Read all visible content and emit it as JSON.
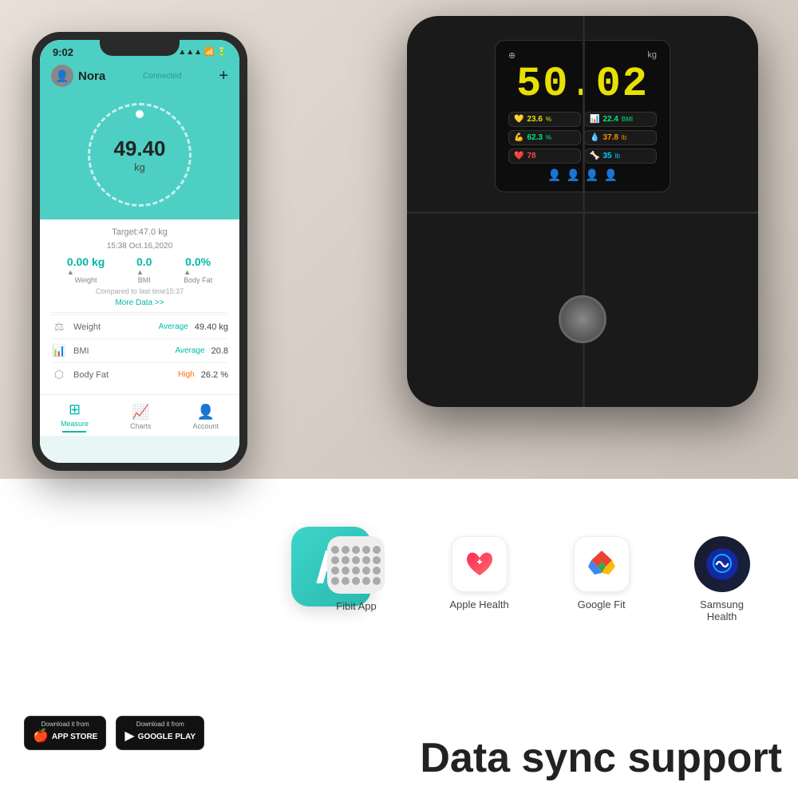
{
  "background": {
    "top_color": "#d8cfc6",
    "bottom_color": "#ffffff"
  },
  "scale": {
    "main_weight": "50.02",
    "unit": "kg",
    "metrics": [
      {
        "icon": "fat",
        "value": "23.6",
        "unit": "%",
        "color": "yellow",
        "label": "Body Fat"
      },
      {
        "icon": "bmi",
        "value": "22.4",
        "unit": "BMI",
        "color": "green",
        "label": "BMI"
      },
      {
        "icon": "muscle",
        "value": "62.3",
        "unit": "%",
        "color": "green",
        "label": "Muscle"
      },
      {
        "icon": "water",
        "value": "37.8",
        "unit": "lb",
        "color": "orange",
        "label": "Water"
      },
      {
        "icon": "heart",
        "value": "78",
        "unit": "",
        "color": "red",
        "label": "Heart Rate"
      },
      {
        "icon": "bone",
        "value": "35",
        "unit": "lb",
        "color": "cyan",
        "label": "Bone Mass"
      }
    ],
    "people_colors": [
      "blue",
      "blue",
      "blue",
      "red"
    ]
  },
  "phone": {
    "status": {
      "time": "9:02",
      "connected": "Connected",
      "signal": "▲▲▲",
      "wifi": "wifi",
      "battery": "battery"
    },
    "user": {
      "name": "Nora",
      "avatar": "👤"
    },
    "weight": {
      "display": "49.40 kg",
      "value": "49.40",
      "unit": "kg"
    },
    "target": "Target:47.0 kg",
    "timestamp": "15:38 Oct.16,2020",
    "stats": [
      {
        "value": "0.00 kg",
        "change": "▲",
        "label": "Weight"
      },
      {
        "value": "0.0",
        "change": "▲",
        "label": "BMI"
      },
      {
        "value": "0.0%",
        "change": "▲",
        "label": "Body Fat"
      }
    ],
    "compared": "Compared to last time15:37",
    "more_data": "More Data >>",
    "metrics": [
      {
        "icon": "⚖",
        "name": "Weight",
        "status": "Average",
        "value": "49.40 kg"
      },
      {
        "icon": "📊",
        "name": "BMI",
        "status": "Average",
        "value": "20.8"
      },
      {
        "icon": "⬡",
        "name": "Body Fat",
        "status": "High",
        "value": "26.2 %"
      }
    ],
    "nav": [
      {
        "label": "Measure",
        "active": true
      },
      {
        "label": "Charts",
        "active": false
      },
      {
        "label": "Account",
        "active": false
      }
    ]
  },
  "sync_apps": [
    {
      "name": "Fibit App",
      "type": "fibit"
    },
    {
      "name": "Apple Health",
      "type": "apple_health"
    },
    {
      "name": "Google Fit",
      "type": "google_fit"
    },
    {
      "name": "Samsung\nHealth",
      "type": "samsung_health"
    }
  ],
  "app_stores": [
    {
      "store": "APP STORE",
      "prefix": "Download it from",
      "icon": "🍎"
    },
    {
      "store": "GOOGLE PLAY",
      "prefix": "Download it from",
      "icon": "▶"
    }
  ],
  "tagline": "Data sync support"
}
